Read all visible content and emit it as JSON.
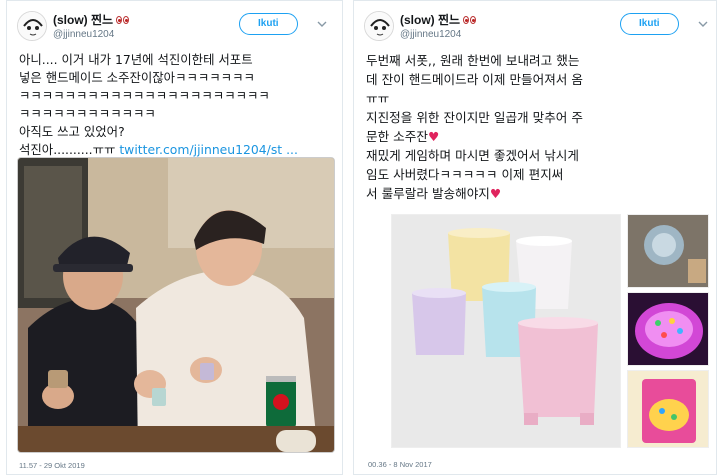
{
  "tweets": [
    {
      "display_name": "(slow) 찐느",
      "handle": "@jjinneu1204",
      "follow_label": "Ikuti",
      "lines": [
        "아니.... 이거 내가 17년에 석진이한테 서포트",
        "넣은 핸드메이드 소주잔이잖아ㅋㅋㅋㅋㅋㅋㅋ",
        "ㅋㅋㅋㅋㅋㅋㅋㅋㅋㅋㅋㅋㅋㅋㅋㅋㅋㅋㅋㅋㅋㅋ",
        "ㅋㅋㅋㅋㅋㅋㅋㅋㅋㅋㅋㅋ",
        "아직도 쓰고 있었어?"
      ],
      "last_line_text": "석진아..........ㅠㅠ ",
      "link_text": "twitter.com/jjinneu1204/st ...",
      "timestamp": "11.57 - 29 Okt 2019"
    },
    {
      "display_name": "(slow) 찐느",
      "handle": "@jjinneu1204",
      "follow_label": "Ikuti",
      "lines": [
        "두번째 서폿,, 원래 한번에 보내려고 했는",
        "데 잔이 핸드메이드라 이제 만들어져서 옴",
        "ㅠㅠ"
      ],
      "line4": "지진정을 위한 잔이지만 일곱개 맞추어 주",
      "line5": "문한 소주잔",
      "line6": "재밌게 게임하며 마시면 좋겠어서 낚시게",
      "line7": "임도 사버렸다ㅋㅋㅋㅋㅋ 이제 편지써",
      "line8": "서 룰루랄라 발송해야지",
      "timestamp": "00.36 - 8 Nov 2017"
    }
  ],
  "colors": {
    "accent": "#1da1f2",
    "heart": "#e0245e",
    "text": "#14171a",
    "muted": "#657786"
  },
  "icons": {
    "chevron": "chevron-down-icon",
    "avatar": "avatar-icon"
  }
}
